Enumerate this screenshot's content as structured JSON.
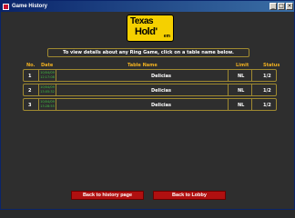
{
  "window": {
    "title": "Game History",
    "minimize": "_",
    "maximize": "□",
    "close": "×"
  },
  "logo": {
    "top": "Texas",
    "bottom": "Hold'",
    "suffix": "em"
  },
  "info_text": "To view details about any Ring Game, click on a table name below.",
  "columns": {
    "no": "No.",
    "date": "Date",
    "table_name": "Table Name",
    "limit": "Limit",
    "status": "Status"
  },
  "rows": [
    {
      "no": "1",
      "date": "10/04/09",
      "time": "12:17:08",
      "table": "Delicias",
      "limit": "NL",
      "status": "1/2"
    },
    {
      "no": "2",
      "date": "10/04/09",
      "time": "13:05:32",
      "table": "Delicias",
      "limit": "NL",
      "status": "1/2"
    },
    {
      "no": "3",
      "date": "10/04/09",
      "time": "13:28:55",
      "table": "Delicias",
      "limit": "NL",
      "status": "1/2"
    }
  ],
  "buttons": {
    "history": "Back to history page",
    "lobby": "Back to Lobby"
  }
}
